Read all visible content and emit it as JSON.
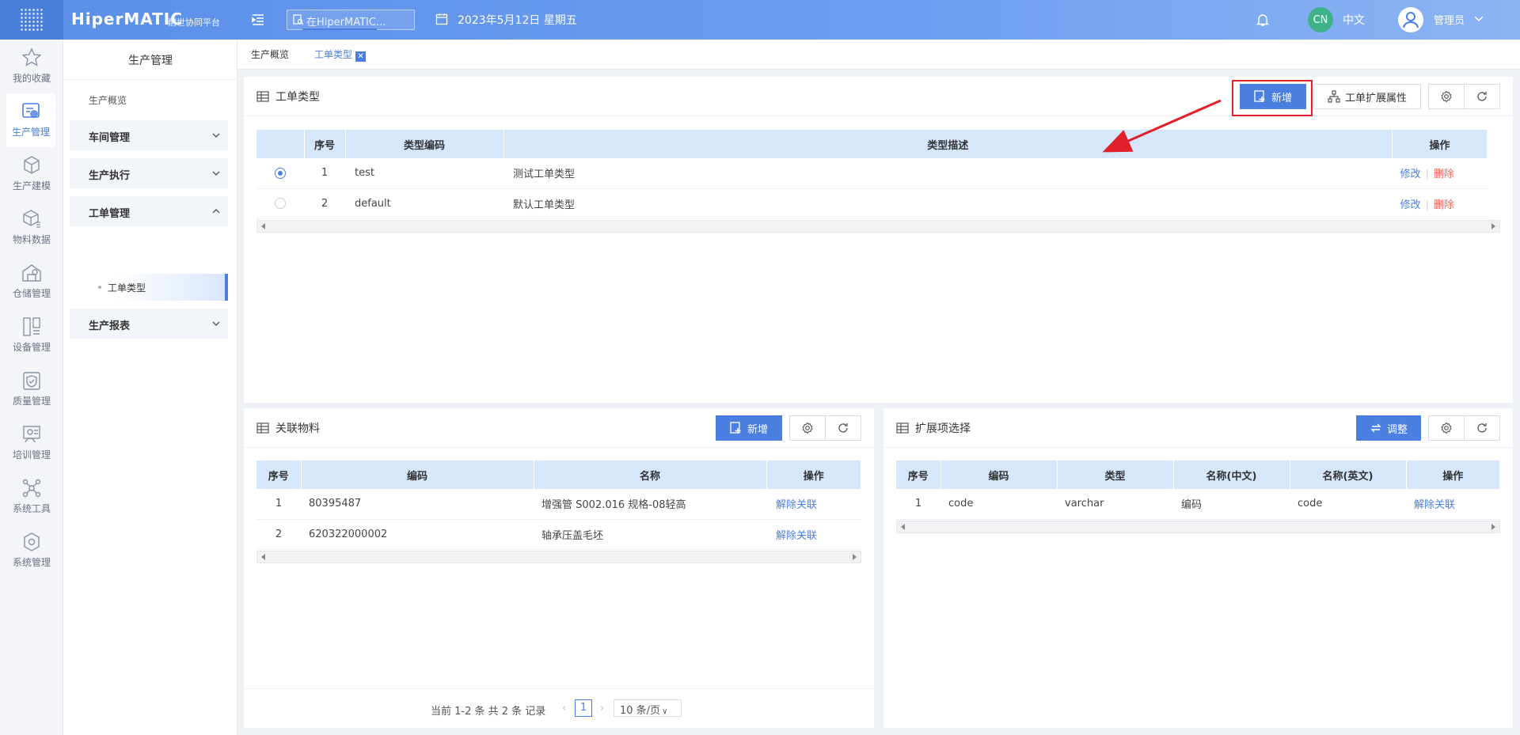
{
  "topbar": {
    "brand": "HiperMATIC",
    "brand_sub": "耐世协同平台",
    "search_placeholder": "在HiperMATIC...",
    "date": "2023年5月12日 星期五",
    "lang_badge": "CN",
    "lang": "中文",
    "user": "管理员"
  },
  "iconnav": [
    {
      "label": "我的收藏",
      "icon": "star-icon"
    },
    {
      "label": "生产管理",
      "icon": "production-icon"
    },
    {
      "label": "生产建模",
      "icon": "cube-icon"
    },
    {
      "label": "物料数据",
      "icon": "box-icon"
    },
    {
      "label": "仓储管理",
      "icon": "warehouse-icon"
    },
    {
      "label": "设备管理",
      "icon": "equipment-icon"
    },
    {
      "label": "质量管理",
      "icon": "quality-icon"
    },
    {
      "label": "培训管理",
      "icon": "training-icon"
    },
    {
      "label": "系统工具",
      "icon": "tools-icon"
    },
    {
      "label": "系统管理",
      "icon": "settings-icon"
    }
  ],
  "submenu": {
    "title": "生产管理",
    "overview": "生产概览",
    "groups": [
      "车间管理",
      "生产执行",
      "工单管理",
      "生产报表"
    ],
    "active_child": "工单类型"
  },
  "tabs": [
    "生产概览",
    "工单类型"
  ],
  "main_panel": {
    "title": "工单类型",
    "btn_add": "新增",
    "btn_ext": "工单扩展属性",
    "columns": [
      "序号",
      "类型编码",
      "类型描述",
      "操作"
    ],
    "rows": [
      {
        "no": "1",
        "code": "test",
        "desc": "测试工单类型"
      },
      {
        "no": "2",
        "code": "default",
        "desc": "默认工单类型"
      }
    ],
    "action_edit": "修改",
    "action_delete": "删除"
  },
  "material_panel": {
    "title": "关联物料",
    "btn_add": "新增",
    "columns": [
      "序号",
      "编码",
      "名称",
      "操作"
    ],
    "rows": [
      {
        "no": "1",
        "code": "80395487",
        "name": "增强管 S002.016 规格-08轻高"
      },
      {
        "no": "2",
        "code": "620322000002",
        "name": "轴承压盖毛坯"
      }
    ],
    "action": "解除关联",
    "pager": {
      "summary": "当前 1-2 条 共 2 条 记录",
      "page": "1",
      "page_size": "10 条/页"
    }
  },
  "ext_panel": {
    "title": "扩展项选择",
    "btn_adjust": "调整",
    "columns": [
      "序号",
      "编码",
      "类型",
      "名称(中文)",
      "名称(英文)",
      "操作"
    ],
    "rows": [
      {
        "no": "1",
        "code": "code",
        "type": "varchar",
        "name_cn": "编码",
        "name_en": "code"
      }
    ],
    "action": "解除关联"
  }
}
